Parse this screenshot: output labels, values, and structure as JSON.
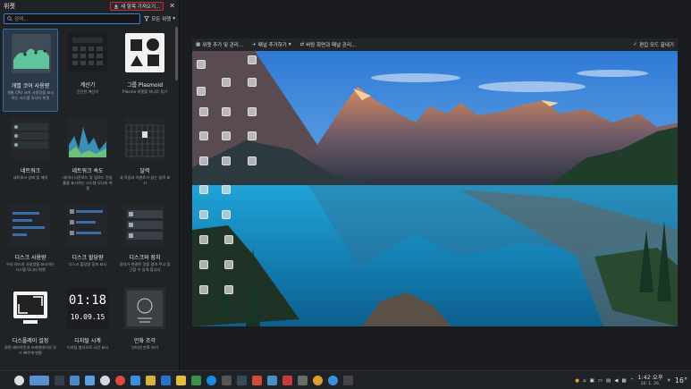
{
  "panel": {
    "title": "위젯",
    "get_new_label": "새 항목 가져오기...",
    "search_placeholder": "검색...",
    "filter_label": "모든 위젯"
  },
  "widgets": [
    {
      "title": "개별 코어 사용량",
      "desc": "개별 CPU 코어 사용량을 표시하는 시스템 모니터 위젯"
    },
    {
      "title": "계산기",
      "desc": "간단한 계산기"
    },
    {
      "title": "그룹 Plasmoid",
      "desc": "Plasma 위젯을 하나로 묶기"
    },
    {
      "title": "네트워크",
      "desc": "네트워크 상태 및 제어"
    },
    {
      "title": "네트워크 속도",
      "desc": "데이터 다운로드 및 업로드 전송률을 표시하는 시스템 모니터 위젯"
    },
    {
      "title": "달력",
      "desc": "내 작업과 이벤트가 있는 달력 표시"
    },
    {
      "title": "디스크 사용량",
      "desc": "우리 하드의 사용량을 표시하는 시스템 모니터 위젯"
    },
    {
      "title": "디스크 할당량",
      "desc": "디스크 할당량 정보 표시"
    },
    {
      "title": "디스크와 장치",
      "desc": "장치가 연결된 것을 알려 주고 접근할 수 있게 합니다"
    },
    {
      "title": "디스플레이 설정",
      "desc": "화면 레이아웃과 프레젠테이션 모드 빠르게 변환"
    },
    {
      "title": "디지털 시계",
      "desc": "디지털 형식으로 시간 표시"
    },
    {
      "title": "만화 조각",
      "desc": "인터넷 만화 보기"
    }
  ],
  "clock_art": {
    "time": "01:18",
    "date": "10.09.15"
  },
  "toolbar": {
    "add_widgets": "위젯 추가 및 관리...",
    "add_panel": "패널 추가하기",
    "configure_screens": "바탕 화면과 패널 관리...",
    "exit_edit": "편집 모드 끝내기"
  },
  "tray": {
    "time": "1:42 오후",
    "date": "26. 1. 26.",
    "temperature": "16°"
  }
}
